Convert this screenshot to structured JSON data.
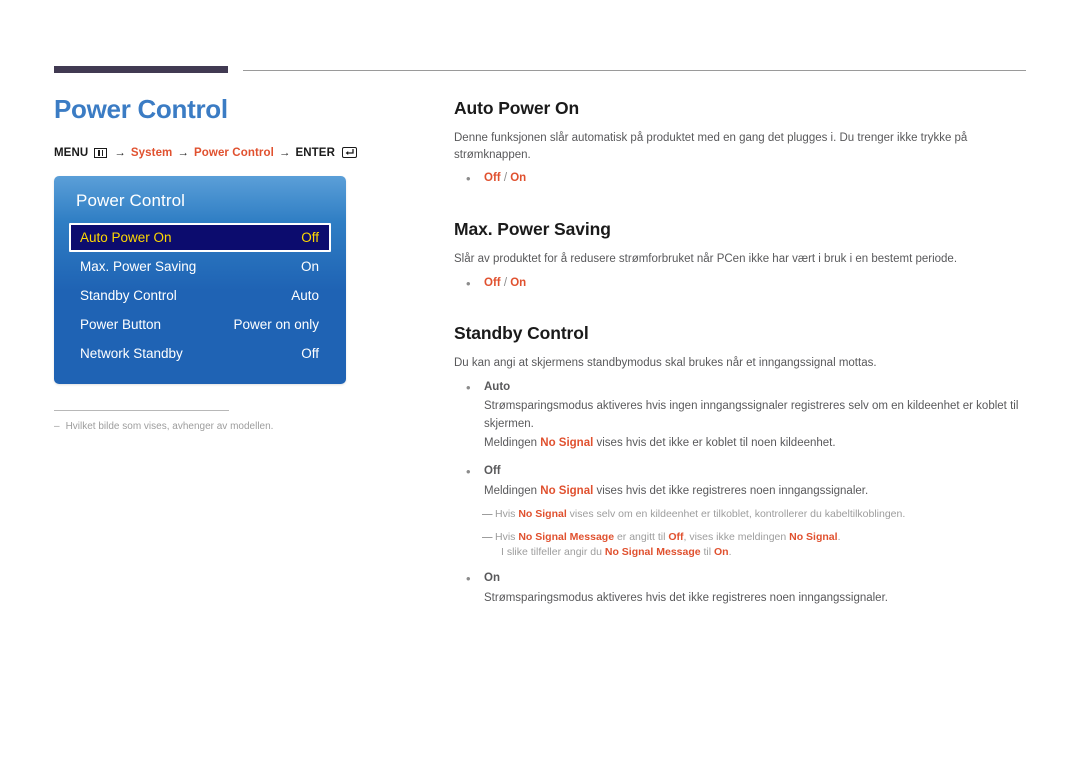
{
  "document": {
    "title": "Power Control",
    "accent_blue": "#3b7cc4",
    "accent_red": "#e0512f",
    "rule_bar_color": "#413a52"
  },
  "menu_path": {
    "menu_label": "MENU",
    "menu_icon": "menu-grid-icon",
    "arrow": "→",
    "item1": "System",
    "item2": "Power Control",
    "enter_label": "ENTER",
    "enter_icon": "enter-key-icon"
  },
  "osd": {
    "title": "Power Control",
    "selected_index": 0,
    "highlight_bg": "#0c0c6e",
    "highlight_text": "#ffd800",
    "rows": [
      {
        "label": "Auto Power On",
        "value": "Off"
      },
      {
        "label": "Max. Power Saving",
        "value": "On"
      },
      {
        "label": "Standby Control",
        "value": "Auto"
      },
      {
        "label": "Power Button",
        "value": "Power on only"
      },
      {
        "label": "Network Standby",
        "value": "Off"
      }
    ]
  },
  "footnote": {
    "dash": "–",
    "text": "Hvilket bilde som vises, avhenger av modellen."
  },
  "sections": {
    "auto_power_on": {
      "title": "Auto Power On",
      "description": "Denne funksjonen slår automatisk på produktet med en gang det plugges i. Du trenger ikke trykke på strømknappen.",
      "option_off": "Off",
      "option_sep": "/",
      "option_on": "On",
      "bullet": "•"
    },
    "max_power_saving": {
      "title": "Max. Power Saving",
      "description": "Slår av produktet for å redusere strømforbruket når PCen ikke har vært i bruk i en bestemt periode.",
      "option_off": "Off",
      "option_sep": "/",
      "option_on": "On",
      "bullet": "•"
    },
    "standby_control": {
      "title": "Standby Control",
      "description": "Du kan angi at skjermens standbymodus skal brukes når et inngangssignal mottas.",
      "bullet": "•",
      "auto": {
        "label": "Auto",
        "line1": "Strømsparingsmodus aktiveres hvis ingen inngangssignaler registreres selv om en kildeenhet er koblet til skjermen.",
        "line2_pre": "Meldingen ",
        "line2_em": "No Signal",
        "line2_post": " vises hvis det ikke er koblet til noen kildeenhet."
      },
      "off": {
        "label": "Off",
        "line1_pre": "Meldingen ",
        "line1_em": "No Signal",
        "line1_post": " vises hvis det ikke registreres noen inngangssignaler."
      },
      "note1": {
        "dash": "—",
        "pre": "Hvis ",
        "em1": "No Signal",
        "post": " vises selv om en kildeenhet er tilkoblet, kontrollerer du kabeltilkoblingen."
      },
      "note2": {
        "dash": "—",
        "pre": "Hvis ",
        "em1": "No Signal Message",
        "mid1": " er angitt til ",
        "em2": "Off",
        "mid2": ", vises ikke meldingen ",
        "em3": "No Signal",
        "post": ".",
        "cont_pre": "I slike tilfeller angir du ",
        "cont_em": "No Signal Message",
        "cont_mid": " til ",
        "cont_em2": "On",
        "cont_post": "."
      },
      "on": {
        "label": "On",
        "line1": "Strømsparingsmodus aktiveres hvis det ikke registreres noen inngangssignaler."
      }
    }
  }
}
